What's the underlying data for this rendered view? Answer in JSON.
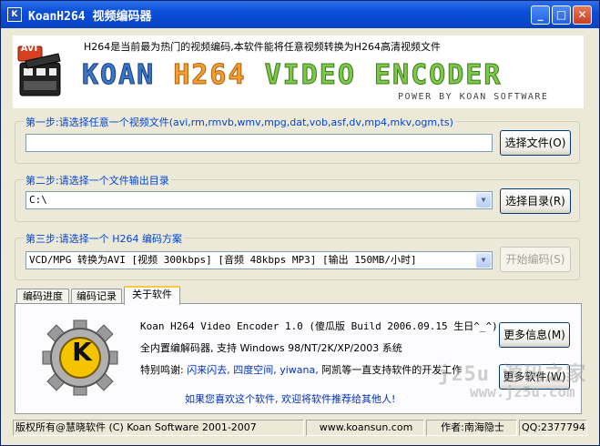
{
  "window": {
    "title": "KoanH264 视频编码器",
    "minimize_label": "_",
    "maximize_label": "□",
    "close_label": "✕"
  },
  "banner": {
    "logo_text": "AVI",
    "note": "H264是当前最为热门的视频编码,本软件能将任意视频转换为H264高清视频文件",
    "title_part1": "KOAN ",
    "title_part2": "H264 ",
    "title_part3": "VIDEO ",
    "title_part4": "ENCODER",
    "powered": "POWER BY KOAN SOFTWARE"
  },
  "step1": {
    "label": "第一步:请选择任意一个视频文件(avi,rm,rmvb,wmv,mpg,dat,vob,asf,dv,mp4,mkv,ogm,ts)",
    "value": "",
    "button": "选择文件(O)"
  },
  "step2": {
    "label": "第二步:请选择一个文件输出目录",
    "value": "C:\\",
    "button": "选择目录(R)"
  },
  "step3": {
    "label": "第三步:请选择一个 H264 编码方案",
    "value": "VCD/MPG  转换为AVI [视频  300kbps] [音频  48kbps MP3] [输出 150MB/小时]",
    "button": "开始编码(S)"
  },
  "tabs": [
    {
      "label": "编码进度"
    },
    {
      "label": "编码记录"
    },
    {
      "label": "关于软件"
    }
  ],
  "about": {
    "logo_letter": "K",
    "line1": "Koan H264 Video Encoder 1.0 (傻瓜版 Build 2006.09.15 生日^_^)",
    "line2": "全内置编解码器, 支持 Windows 98/NT/2K/XP/2003 系统",
    "thanks_prefix": "特别鸣谢: ",
    "thanks_names": "闪来闪去, 四度空间, yiwana,",
    "thanks_suffix": " 阿凯等一直支持软件的开发工作",
    "ask": "如果您喜欢这个软件, 欢迎将软件推荐给其他人!",
    "more_info_button": "更多信息(M)",
    "more_software_button": "更多软件(W)"
  },
  "status": {
    "copyright": "版权所有@慧晓软件 (C) Koan Software 2001-2007",
    "website": "www.koansun.com",
    "author": "作者:南海隐士",
    "qq": "QQ:23777943"
  },
  "watermark": {
    "line1": "jz5u 源码之家",
    "line2": "www.jz5u.com"
  },
  "colors": {
    "titlebar": "#0A4FD9",
    "group_label": "#0046D5",
    "face": "#ECE9D8"
  }
}
